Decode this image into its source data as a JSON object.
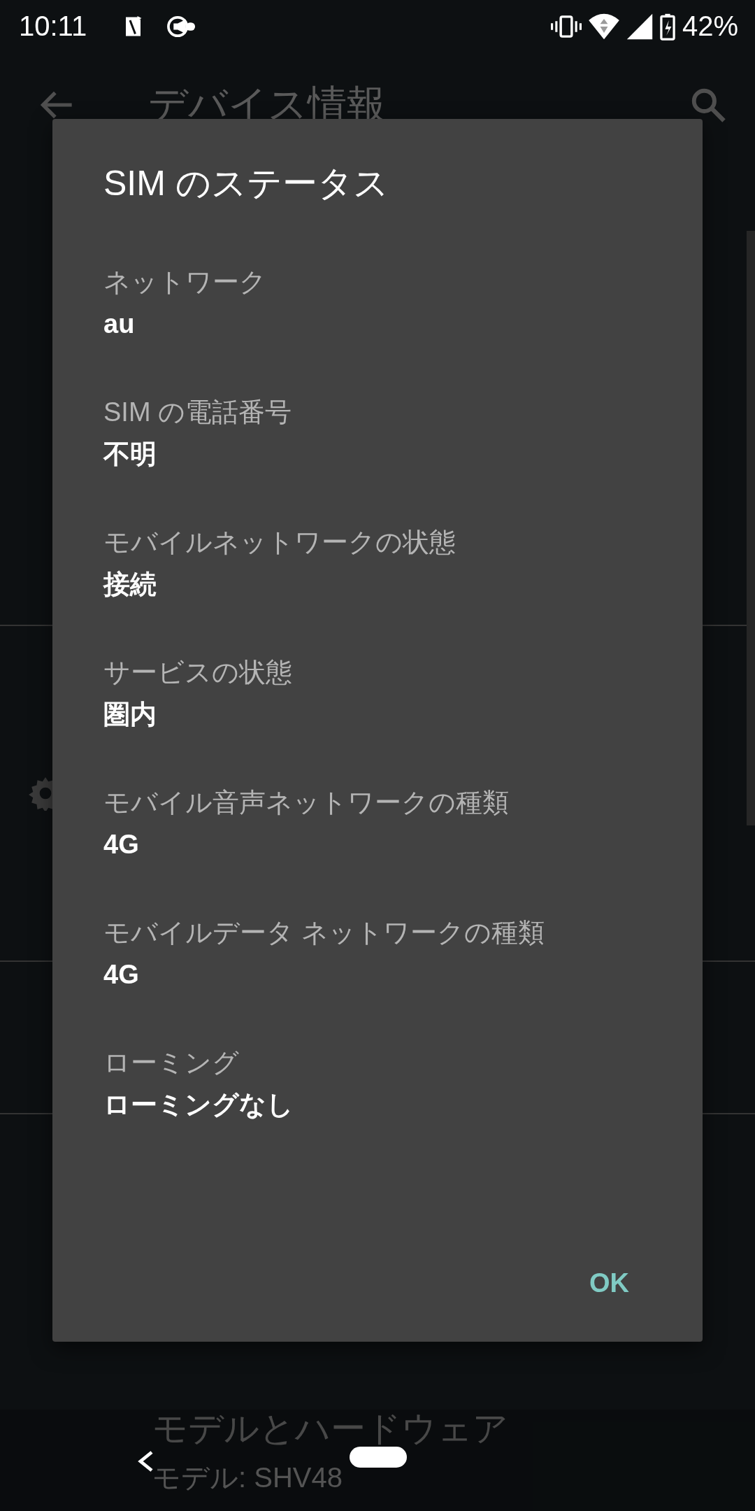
{
  "status_bar": {
    "time": "10:11",
    "battery": "42%"
  },
  "app_bar": {
    "title": "デバイス情報"
  },
  "dialog": {
    "title": "SIM のステータス",
    "items": [
      {
        "label": "ネットワーク",
        "value": "au"
      },
      {
        "label": "SIM の電話番号",
        "value": "不明"
      },
      {
        "label": "モバイルネットワークの状態",
        "value": "接続"
      },
      {
        "label": "サービスの状態",
        "value": "圏内"
      },
      {
        "label": "モバイル音声ネットワークの種類",
        "value": "4G"
      },
      {
        "label": "モバイルデータ ネットワークの種類",
        "value": "4G"
      },
      {
        "label": "ローミング",
        "value": "ローミングなし"
      }
    ],
    "buttons": [
      "OK"
    ]
  },
  "background_item": {
    "title": "モデルとハードウェア",
    "summary": "モデル: SHV48"
  }
}
